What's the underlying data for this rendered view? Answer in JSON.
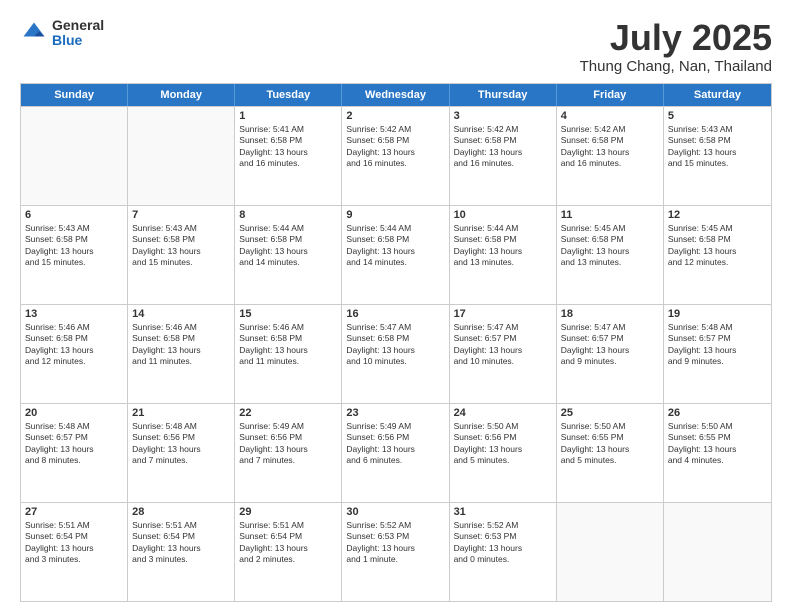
{
  "logo": {
    "general": "General",
    "blue": "Blue"
  },
  "header": {
    "month": "July 2025",
    "location": "Thung Chang, Nan, Thailand"
  },
  "days": [
    "Sunday",
    "Monday",
    "Tuesday",
    "Wednesday",
    "Thursday",
    "Friday",
    "Saturday"
  ],
  "weeks": [
    [
      {
        "day": "",
        "lines": []
      },
      {
        "day": "",
        "lines": []
      },
      {
        "day": "1",
        "lines": [
          "Sunrise: 5:41 AM",
          "Sunset: 6:58 PM",
          "Daylight: 13 hours",
          "and 16 minutes."
        ]
      },
      {
        "day": "2",
        "lines": [
          "Sunrise: 5:42 AM",
          "Sunset: 6:58 PM",
          "Daylight: 13 hours",
          "and 16 minutes."
        ]
      },
      {
        "day": "3",
        "lines": [
          "Sunrise: 5:42 AM",
          "Sunset: 6:58 PM",
          "Daylight: 13 hours",
          "and 16 minutes."
        ]
      },
      {
        "day": "4",
        "lines": [
          "Sunrise: 5:42 AM",
          "Sunset: 6:58 PM",
          "Daylight: 13 hours",
          "and 16 minutes."
        ]
      },
      {
        "day": "5",
        "lines": [
          "Sunrise: 5:43 AM",
          "Sunset: 6:58 PM",
          "Daylight: 13 hours",
          "and 15 minutes."
        ]
      }
    ],
    [
      {
        "day": "6",
        "lines": [
          "Sunrise: 5:43 AM",
          "Sunset: 6:58 PM",
          "Daylight: 13 hours",
          "and 15 minutes."
        ]
      },
      {
        "day": "7",
        "lines": [
          "Sunrise: 5:43 AM",
          "Sunset: 6:58 PM",
          "Daylight: 13 hours",
          "and 15 minutes."
        ]
      },
      {
        "day": "8",
        "lines": [
          "Sunrise: 5:44 AM",
          "Sunset: 6:58 PM",
          "Daylight: 13 hours",
          "and 14 minutes."
        ]
      },
      {
        "day": "9",
        "lines": [
          "Sunrise: 5:44 AM",
          "Sunset: 6:58 PM",
          "Daylight: 13 hours",
          "and 14 minutes."
        ]
      },
      {
        "day": "10",
        "lines": [
          "Sunrise: 5:44 AM",
          "Sunset: 6:58 PM",
          "Daylight: 13 hours",
          "and 13 minutes."
        ]
      },
      {
        "day": "11",
        "lines": [
          "Sunrise: 5:45 AM",
          "Sunset: 6:58 PM",
          "Daylight: 13 hours",
          "and 13 minutes."
        ]
      },
      {
        "day": "12",
        "lines": [
          "Sunrise: 5:45 AM",
          "Sunset: 6:58 PM",
          "Daylight: 13 hours",
          "and 12 minutes."
        ]
      }
    ],
    [
      {
        "day": "13",
        "lines": [
          "Sunrise: 5:46 AM",
          "Sunset: 6:58 PM",
          "Daylight: 13 hours",
          "and 12 minutes."
        ]
      },
      {
        "day": "14",
        "lines": [
          "Sunrise: 5:46 AM",
          "Sunset: 6:58 PM",
          "Daylight: 13 hours",
          "and 11 minutes."
        ]
      },
      {
        "day": "15",
        "lines": [
          "Sunrise: 5:46 AM",
          "Sunset: 6:58 PM",
          "Daylight: 13 hours",
          "and 11 minutes."
        ]
      },
      {
        "day": "16",
        "lines": [
          "Sunrise: 5:47 AM",
          "Sunset: 6:58 PM",
          "Daylight: 13 hours",
          "and 10 minutes."
        ]
      },
      {
        "day": "17",
        "lines": [
          "Sunrise: 5:47 AM",
          "Sunset: 6:57 PM",
          "Daylight: 13 hours",
          "and 10 minutes."
        ]
      },
      {
        "day": "18",
        "lines": [
          "Sunrise: 5:47 AM",
          "Sunset: 6:57 PM",
          "Daylight: 13 hours",
          "and 9 minutes."
        ]
      },
      {
        "day": "19",
        "lines": [
          "Sunrise: 5:48 AM",
          "Sunset: 6:57 PM",
          "Daylight: 13 hours",
          "and 9 minutes."
        ]
      }
    ],
    [
      {
        "day": "20",
        "lines": [
          "Sunrise: 5:48 AM",
          "Sunset: 6:57 PM",
          "Daylight: 13 hours",
          "and 8 minutes."
        ]
      },
      {
        "day": "21",
        "lines": [
          "Sunrise: 5:48 AM",
          "Sunset: 6:56 PM",
          "Daylight: 13 hours",
          "and 7 minutes."
        ]
      },
      {
        "day": "22",
        "lines": [
          "Sunrise: 5:49 AM",
          "Sunset: 6:56 PM",
          "Daylight: 13 hours",
          "and 7 minutes."
        ]
      },
      {
        "day": "23",
        "lines": [
          "Sunrise: 5:49 AM",
          "Sunset: 6:56 PM",
          "Daylight: 13 hours",
          "and 6 minutes."
        ]
      },
      {
        "day": "24",
        "lines": [
          "Sunrise: 5:50 AM",
          "Sunset: 6:56 PM",
          "Daylight: 13 hours",
          "and 5 minutes."
        ]
      },
      {
        "day": "25",
        "lines": [
          "Sunrise: 5:50 AM",
          "Sunset: 6:55 PM",
          "Daylight: 13 hours",
          "and 5 minutes."
        ]
      },
      {
        "day": "26",
        "lines": [
          "Sunrise: 5:50 AM",
          "Sunset: 6:55 PM",
          "Daylight: 13 hours",
          "and 4 minutes."
        ]
      }
    ],
    [
      {
        "day": "27",
        "lines": [
          "Sunrise: 5:51 AM",
          "Sunset: 6:54 PM",
          "Daylight: 13 hours",
          "and 3 minutes."
        ]
      },
      {
        "day": "28",
        "lines": [
          "Sunrise: 5:51 AM",
          "Sunset: 6:54 PM",
          "Daylight: 13 hours",
          "and 3 minutes."
        ]
      },
      {
        "day": "29",
        "lines": [
          "Sunrise: 5:51 AM",
          "Sunset: 6:54 PM",
          "Daylight: 13 hours",
          "and 2 minutes."
        ]
      },
      {
        "day": "30",
        "lines": [
          "Sunrise: 5:52 AM",
          "Sunset: 6:53 PM",
          "Daylight: 13 hours",
          "and 1 minute."
        ]
      },
      {
        "day": "31",
        "lines": [
          "Sunrise: 5:52 AM",
          "Sunset: 6:53 PM",
          "Daylight: 13 hours",
          "and 0 minutes."
        ]
      },
      {
        "day": "",
        "lines": []
      },
      {
        "day": "",
        "lines": []
      }
    ]
  ]
}
